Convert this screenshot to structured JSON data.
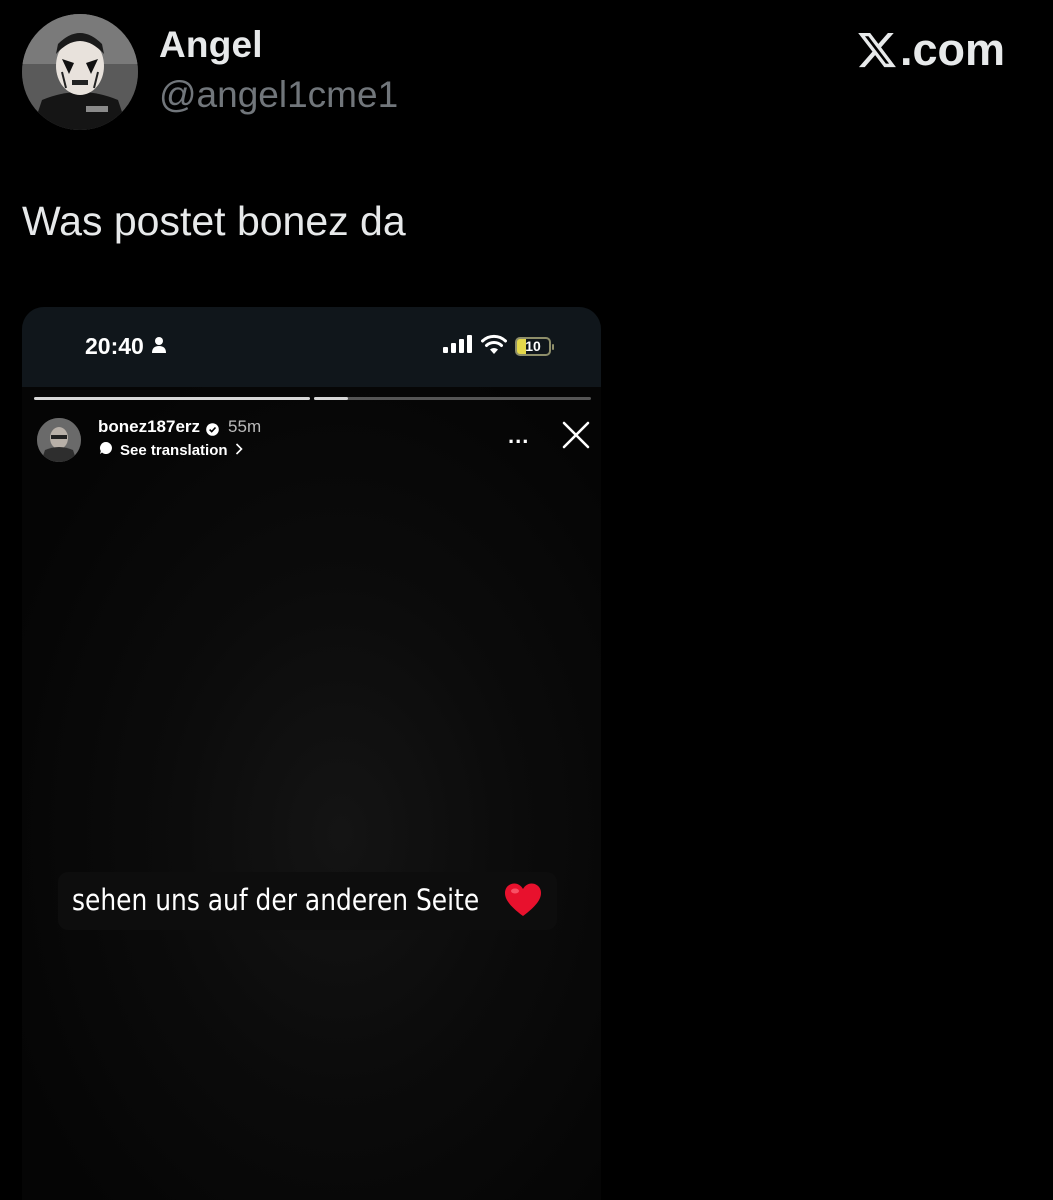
{
  "tweet": {
    "display_name": "Angel",
    "handle": "@angel1cme1",
    "brand": ".com",
    "text": "Was postet bonez da"
  },
  "media": {
    "status_bar": {
      "time": "20:40",
      "battery": "10",
      "icons": [
        "person-icon",
        "signal-icon",
        "wifi-icon",
        "battery-icon"
      ]
    },
    "story": {
      "progress_segments": 2,
      "username": "bonez187erz",
      "time_ago": "55m",
      "translate_label": "See translation",
      "more_label": "...",
      "caption": "sehen uns auf der anderen Seite",
      "caption_emoji": "heart-emoji",
      "icons": [
        "verified-icon",
        "translate-bubble-icon",
        "chevron-right-icon",
        "more-icon",
        "close-icon"
      ]
    }
  },
  "colors": {
    "background": "#000000",
    "primary_text": "#e7e9ea",
    "secondary_text": "#71767b",
    "status_bar": "#10161b",
    "battery_fill": "#e5d84a",
    "heart": "#e8112d"
  }
}
